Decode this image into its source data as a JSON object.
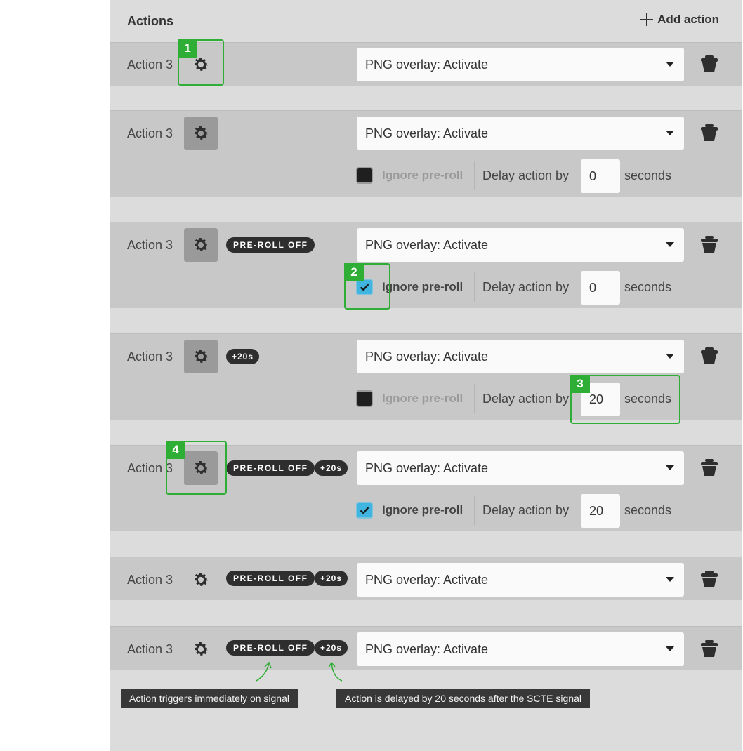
{
  "header": {
    "title": "Actions",
    "add_label": "Add action"
  },
  "rows": [
    {
      "label": "Action 3",
      "select": "PNG overlay: Activate"
    },
    {
      "label": "Action 3",
      "select": "PNG overlay: Activate",
      "ignore_label": "Ignore pre-roll",
      "ignore_checked": false,
      "delay_label": "Delay action by",
      "delay_value": "0",
      "seconds_label": "seconds"
    },
    {
      "label": "Action 3",
      "select": "PNG overlay: Activate",
      "badge_preroll": "PRE-ROLL OFF",
      "ignore_label": "Ignore pre-roll",
      "ignore_checked": true,
      "delay_label": "Delay action by",
      "delay_value": "0",
      "seconds_label": "seconds"
    },
    {
      "label": "Action 3",
      "select": "PNG overlay: Activate",
      "badge_delay": "+20s",
      "ignore_label": "Ignore pre-roll",
      "ignore_checked": false,
      "delay_label": "Delay action by",
      "delay_value": "20",
      "seconds_label": "seconds"
    },
    {
      "label": "Action 3",
      "select": "PNG overlay: Activate",
      "badge_preroll": "PRE-ROLL OFF",
      "badge_delay": "+20s",
      "ignore_label": "Ignore pre-roll",
      "ignore_checked": true,
      "delay_label": "Delay action by",
      "delay_value": "20",
      "seconds_label": "seconds"
    },
    {
      "label": "Action 3",
      "select": "PNG overlay: Activate",
      "badge_preroll": "PRE-ROLL OFF",
      "badge_delay": "+20s"
    },
    {
      "label": "Action 3",
      "select": "PNG overlay: Activate",
      "badge_preroll": "PRE-ROLL OFF",
      "badge_delay": "+20s"
    }
  ],
  "callouts": [
    "1",
    "2",
    "3",
    "4"
  ],
  "tooltips": {
    "preroll": "Action triggers immediately on signal",
    "delay": "Action is delayed by 20 seconds after the SCTE signal"
  },
  "colors": {
    "callout": "#2fae36",
    "checkbox_on": "#3fb5e0",
    "panel": "#dcdcdc",
    "row": "#c8c8c8"
  },
  "icons": [
    "plus-icon",
    "gear-icon",
    "chevron-down-icon",
    "trash-icon",
    "checkmark-icon"
  ]
}
